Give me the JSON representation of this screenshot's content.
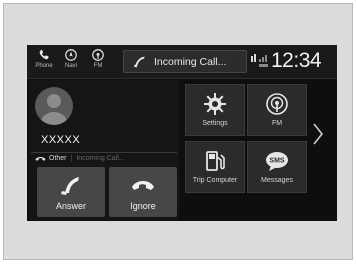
{
  "topbar": {
    "shortcuts": [
      {
        "label": "Phone",
        "icon": "phone-icon"
      },
      {
        "label": "Navi",
        "icon": "navi-icon"
      },
      {
        "label": "FM",
        "icon": "fm-icon"
      }
    ],
    "call_status": "Incoming Call...",
    "clock": "12:34"
  },
  "call": {
    "caller_name": "XXXXX",
    "caller_type": "Other",
    "caller_status": "Incoming Call...",
    "answer_label": "Answer",
    "ignore_label": "Ignore"
  },
  "tiles": [
    {
      "label": "Settings",
      "icon": "settings-gear-icon"
    },
    {
      "label": "FM",
      "icon": "radio-icon"
    },
    {
      "label": "Trip Computer",
      "icon": "fuel-pump-icon"
    },
    {
      "label": "Messages",
      "icon": "sms-icon"
    }
  ],
  "colors": {
    "screen_bg": "#0e0e0e",
    "tile_bg": "#2b2b2b",
    "button_bg": "#474747",
    "text": "#f0f0f0"
  }
}
